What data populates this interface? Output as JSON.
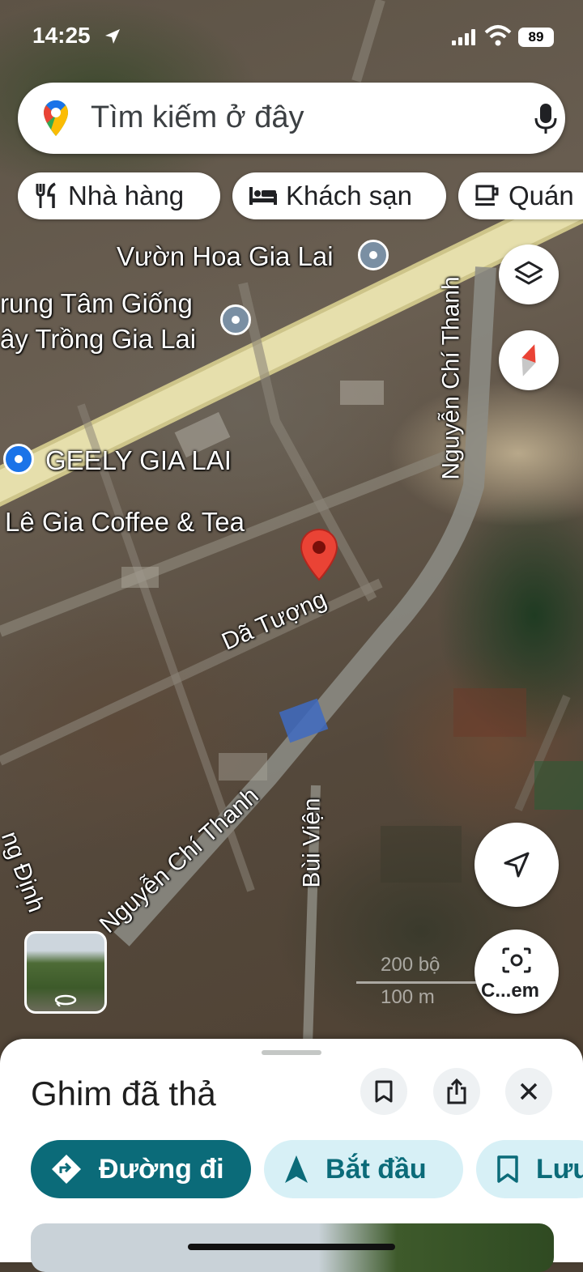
{
  "status_bar": {
    "time": "14:25",
    "battery": "89"
  },
  "search": {
    "placeholder": "Tìm kiếm ở đây"
  },
  "chips": [
    {
      "label": "Nhà hàng",
      "icon": "restaurant-icon"
    },
    {
      "label": "Khách sạn",
      "icon": "hotel-icon"
    },
    {
      "label": "Quán",
      "icon": "cafe-icon"
    }
  ],
  "map": {
    "poi_labels": {
      "vuon_hoa": "Vườn Hoa Gia Lai",
      "trung_tam_1": "rung Tâm Giống",
      "trung_tam_2": "ây Trồng Gia Lai",
      "geely": "GEELY GIA LAI",
      "le_gia": "Lê Gia Coffee & Tea"
    },
    "street_labels": {
      "nguyen_chi_thanh_top": "Nguyễn Chí Thanh",
      "da_tuong": "Dã Tượng",
      "nguyen_chi_thanh_bottom": "Nguyễn Chí Thanh",
      "bui_vien": "Bùi Viện",
      "ng_dinh": "ng Định"
    },
    "scale": {
      "feet": "200 bộ",
      "meters": "100 m"
    },
    "pin_color": "#ea4335"
  },
  "controls": {
    "lens_label": "C...em"
  },
  "sheet": {
    "title": "Ghim đã thả",
    "actions": {
      "directions": "Đường đi",
      "start": "Bắt đầu",
      "save": "Lưu"
    }
  },
  "colors": {
    "accent": "#0b6b79",
    "chip_light": "#d7f0f6"
  }
}
